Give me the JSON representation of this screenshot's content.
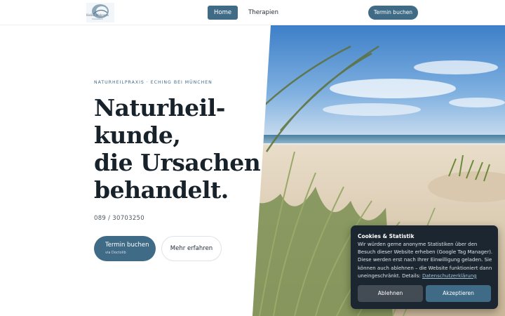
{
  "header": {
    "logo_text": "Heike Mahoutis",
    "logo_sub": "Heilpraktikerin",
    "nav": [
      {
        "label": "Home",
        "active": true
      },
      {
        "label": "Therapien",
        "active": false
      }
    ],
    "cta_label": "Termin buchen"
  },
  "hero": {
    "eyebrow": "NATURHEILPRAXIS · ECHING BEI MÜNCHEN",
    "headline_lines": [
      "Naturheil-",
      "kunde,",
      "die Ursachen",
      "behandelt."
    ],
    "phone": "089 / 30703250",
    "primary_button": {
      "label": "Termin buchen",
      "sub": "via Doctolib"
    },
    "secondary_button": "Mehr erfahren",
    "image_icon": "beach-dune-grass-photo"
  },
  "cookie_banner": {
    "title": "Cookies & Statistik",
    "text": "Wir würden gerne anonyme Statistiken über den Besuch dieser Website erheben (Google Tag Manager). Diese werden erst nach Ihrer Einwilligung geladen. Sie können auch ablehnen – die Website funktioniert dann uneingeschränkt. Details: ",
    "link": "Datenschutzerklärung",
    "decline": "Ablehnen",
    "accept": "Akzeptieren"
  },
  "colors": {
    "accent": "#3f6b86",
    "cookie_bg": "#1c2630",
    "heading": "#17222b"
  }
}
